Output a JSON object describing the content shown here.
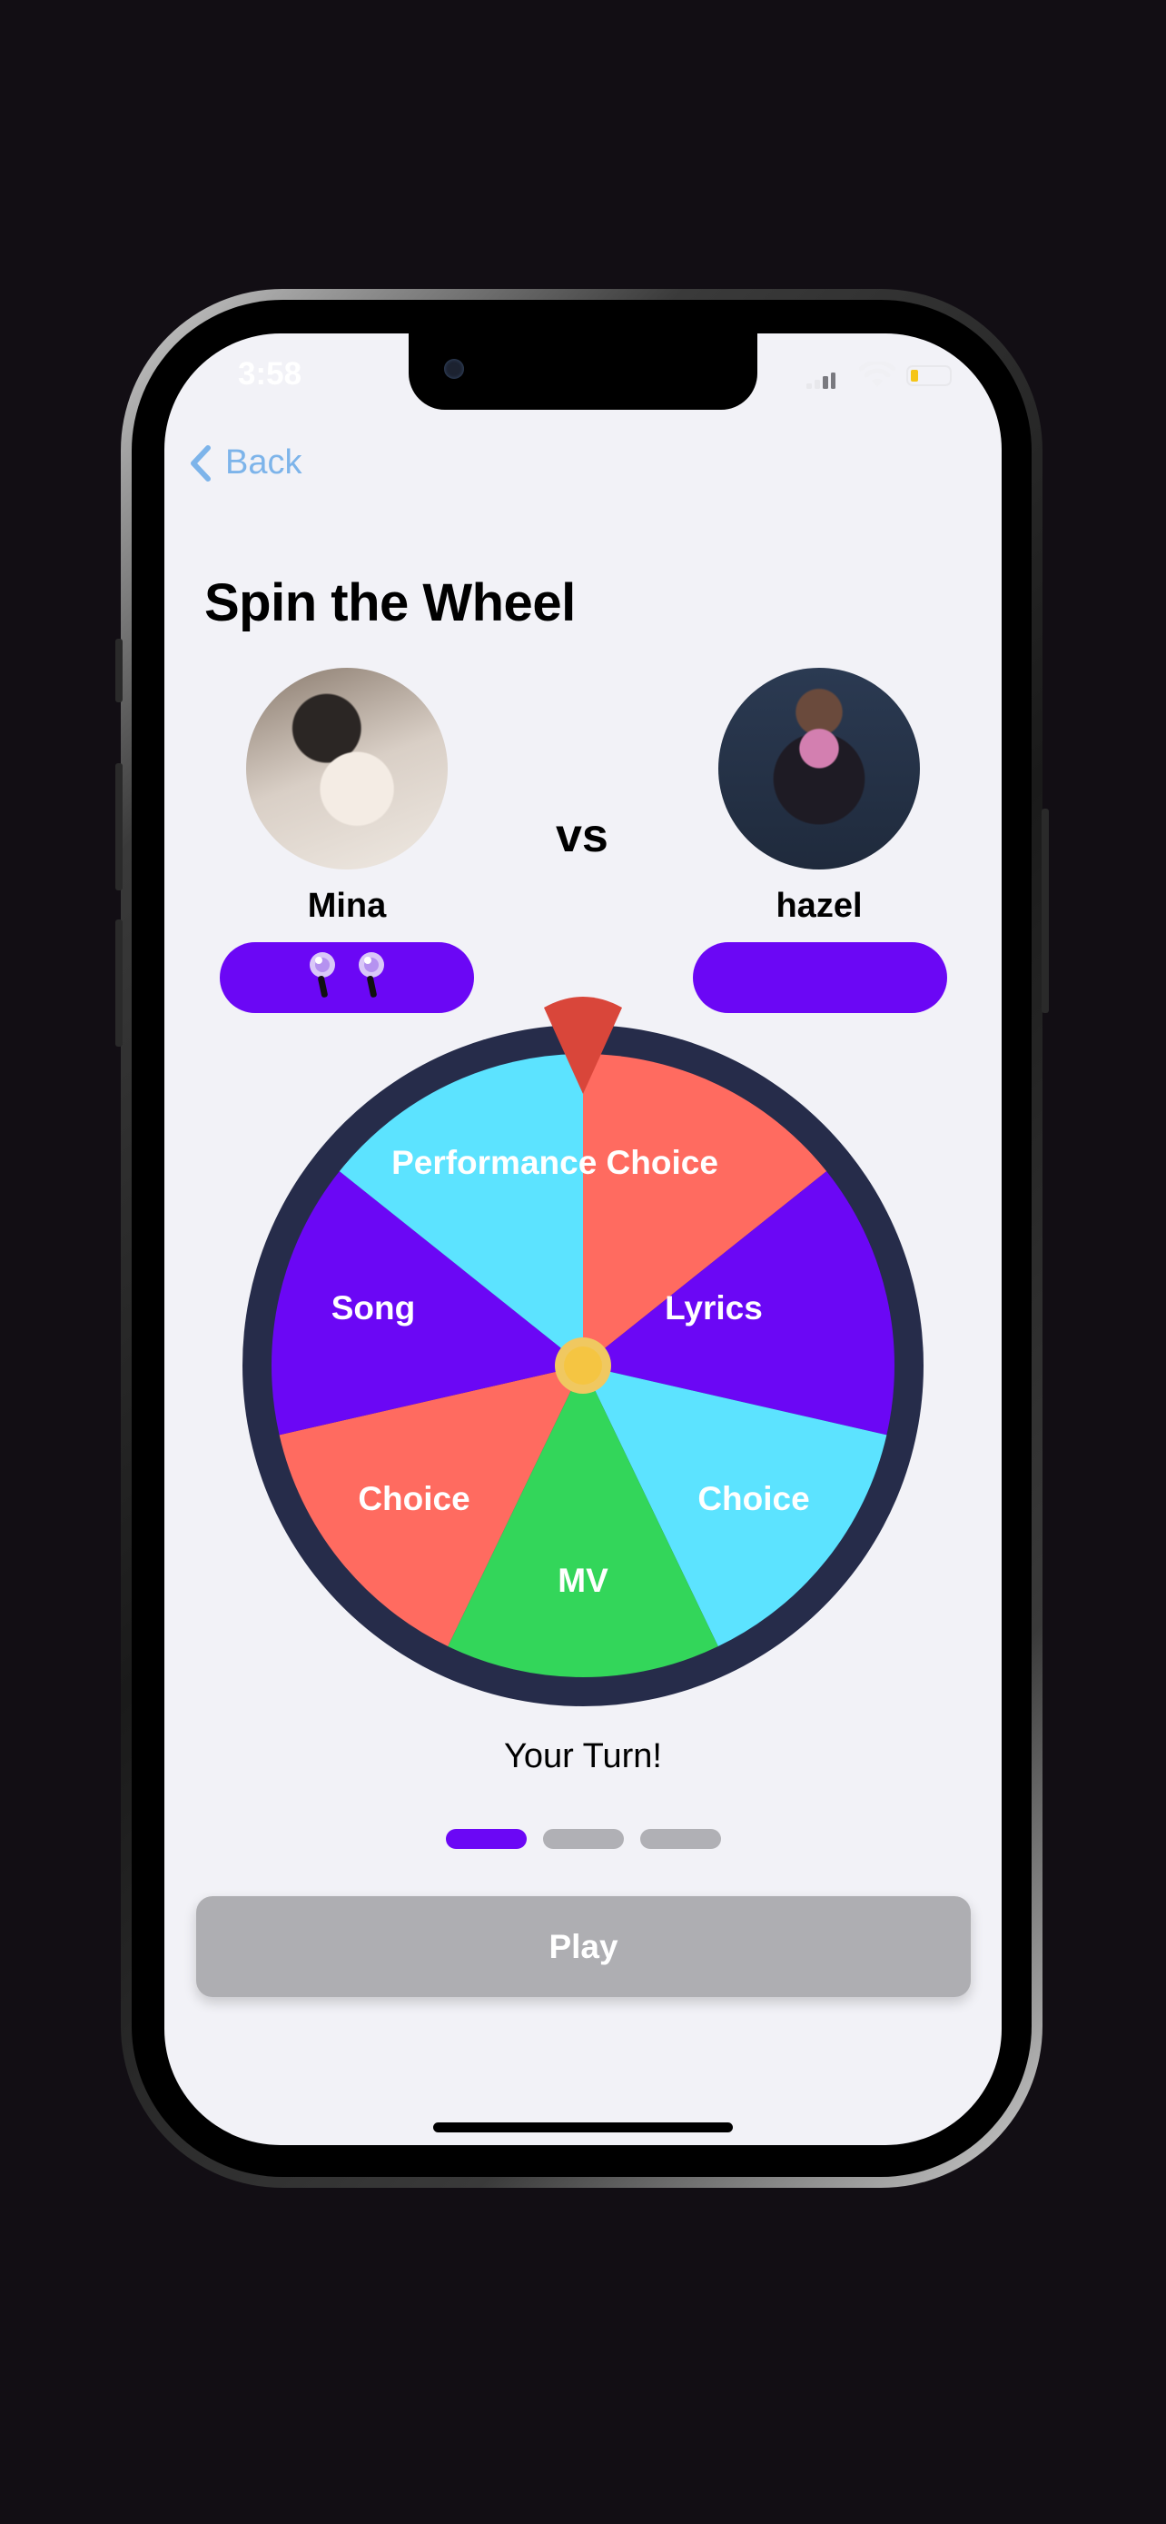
{
  "status_bar": {
    "time": "3:58"
  },
  "nav": {
    "back_label": "Back"
  },
  "title": "Spin the Wheel",
  "match": {
    "vs_label": "vs",
    "player_left": {
      "name": "Mina",
      "score_icons": 2
    },
    "player_right": {
      "name": "hazel",
      "score_icons": 0
    }
  },
  "wheel": {
    "segments": [
      {
        "label": "Performance Choice",
        "color": "#ff6b60"
      },
      {
        "label": "Lyrics",
        "color": "#6b07f5"
      },
      {
        "label": "Choice",
        "color": "#5ce3ff"
      },
      {
        "label": "MV",
        "color": "#33d65a"
      },
      {
        "label": "Choice",
        "color": "#ff6b60"
      },
      {
        "label": "Song",
        "color": "#6b07f5"
      },
      {
        "label": "",
        "color": "#5ce3ff"
      }
    ],
    "rim_color": "#262c4a",
    "pointer_color": "#d9463a",
    "hub_color": "#f5c542"
  },
  "turn_label": "Your Turn!",
  "progress": {
    "total": 3,
    "current": 1
  },
  "play_label": "Play",
  "colors": {
    "accent": "#6b07f5",
    "link": "#7db4ea",
    "disabled": "#aeaeb2"
  }
}
